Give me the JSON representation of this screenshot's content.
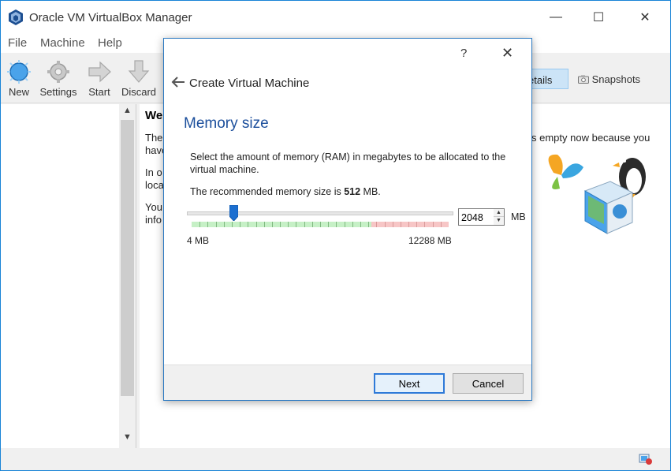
{
  "window": {
    "title": "Oracle VM VirtualBox Manager",
    "min_symbol": "—",
    "max_symbol": "☐",
    "close_symbol": "✕"
  },
  "menu": [
    "File",
    "Machine",
    "Help"
  ],
  "toolbar": {
    "new_label": "New",
    "settings_label": "Settings",
    "start_label": "Start",
    "discard_label": "Discard"
  },
  "tabs": {
    "details_label": "etails",
    "snapshots_label": "Snapshots"
  },
  "welcome": {
    "title": "We",
    "line1a": "The",
    "line1b": "have",
    "line2a": "In o",
    "line2b": "loca",
    "line3a": "You",
    "line3b": "info",
    "right_text": "s empty now because you"
  },
  "dialog": {
    "help_symbol": "?",
    "close_symbol": "✕",
    "heading": "Create Virtual Machine",
    "section_title": "Memory size",
    "description": "Select the amount of memory (RAM) in megabytes to be allocated to the virtual machine.",
    "recommended_prefix": "The recommended memory size is ",
    "recommended_value": "512",
    "recommended_suffix": " MB.",
    "memory_value": "2048",
    "memory_fraction": 0.1664,
    "unit": "MB",
    "min_label": "4 MB",
    "max_label": "12288 MB",
    "next_label": "Next",
    "cancel_label": "Cancel"
  },
  "colors": {
    "accent": "#2f7ad8",
    "heading": "#1c4f9c",
    "scale_green": "#c6f0c6",
    "scale_red": "#f7c6c6"
  },
  "icons": [
    "virtualbox-icon",
    "new-icon",
    "settings-icon",
    "start-icon",
    "discard-icon",
    "camera-icon",
    "back-arrow-icon",
    "status-icon"
  ]
}
